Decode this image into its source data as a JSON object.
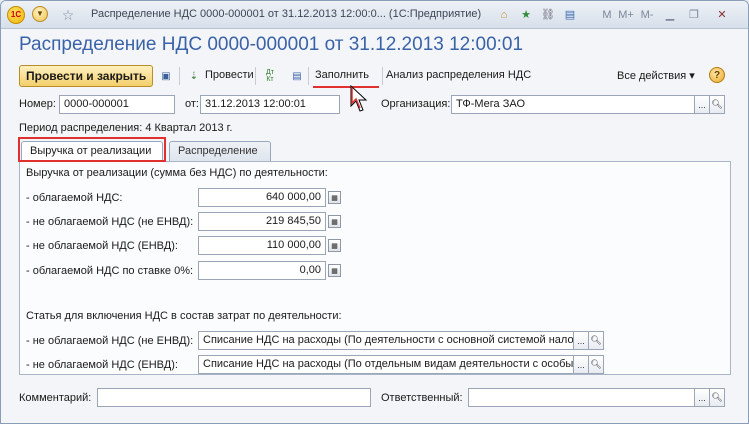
{
  "window": {
    "title": "Распределение НДС 0000-000001 от 31.12.2013 12:00:0... (1С:Предприятие)",
    "logo_text": "1С",
    "icons": [
      "1c-logo-icon",
      "menu-icon",
      "star-icon",
      "home-icon",
      "star-icon",
      "link-icon",
      "memory-icon",
      "minimize-icon",
      "restore-icon",
      "close-icon"
    ],
    "controls": {
      "m": "M",
      "mplus": "M+",
      "mminus": "M-"
    }
  },
  "document": {
    "title": "Распределение НДС 0000-000001 от 31.12.2013 12:00:01"
  },
  "toolbar": {
    "post_close_label": "Провести и закрыть",
    "post_label": "Провести",
    "fill_label": "Заполнить",
    "analysis_label": "Анализ распределения НДС",
    "all_actions_label": "Все действия ▾",
    "help_label": "?",
    "dtkt_label": "Дт\nКт"
  },
  "header": {
    "number_label": "Номер:",
    "number_value": "0000-000001",
    "date_label": "от:",
    "date_value": "31.12.2013 12:00:01",
    "org_label": "Организация:",
    "org_value": "ТФ-Мега ЗАО",
    "period_text": "Период распределения:  4 Квартал 2013  г."
  },
  "tabs": [
    {
      "label": "Выручка от реализации",
      "active": true
    },
    {
      "label": "Распределение",
      "active": false
    }
  ],
  "revenue": {
    "section_title": "Выручка от реализации (сумма без НДС) по деятельности:",
    "rows": [
      {
        "label": "- облагаемой НДС:",
        "value": "640 000,00"
      },
      {
        "label": "- не облагаемой НДС (не ЕНВД):",
        "value": "219 845,50"
      },
      {
        "label": "- не облагаемой НДС (ЕНВД):",
        "value": "110 000,00"
      },
      {
        "label": "- облагаемой НДС по ставке 0%:",
        "value": "0,00"
      }
    ],
    "articles_title": "Статья для включения НДС в состав затрат по деятельности:",
    "articles": [
      {
        "label": "- не облагаемой НДС (не ЕНВД):",
        "value": "Списание НДС на расходы (По деятельности с основной системой налог"
      },
      {
        "label": "- не облагаемой НДС (ЕНВД):",
        "value": "Списание НДС на расходы (По отдельным видам деятельности с особым"
      }
    ]
  },
  "footer": {
    "comment_label": "Комментарий:",
    "comment_value": "",
    "responsible_label": "Ответственный:",
    "responsible_value": ""
  },
  "colors": {
    "title_blue": "#3a62a8",
    "highlight_red": "#e03030",
    "primary_button": "#f3cf6a"
  }
}
